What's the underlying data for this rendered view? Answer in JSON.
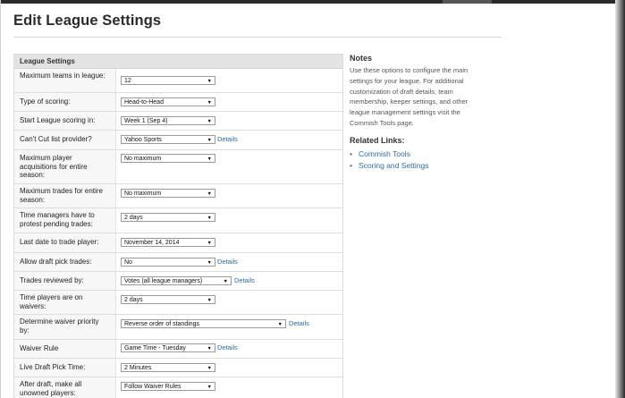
{
  "page_title": "Edit League Settings",
  "settings_header": "League Settings",
  "rows": [
    {
      "label": "Maximum teams in league:",
      "value": "12",
      "details": ""
    },
    {
      "label": "Type of scoring:",
      "value": "Head-to-Head",
      "details": ""
    },
    {
      "label": "Start League scoring in:",
      "value": "Week 1 (Sep 4)",
      "details": ""
    },
    {
      "label": "Can't Cut list provider?",
      "value": "Yahoo Sports",
      "details": "Details"
    },
    {
      "label": "Maximum player acquisitions for entire season:",
      "value": "No maximum",
      "details": ""
    },
    {
      "label": "Maximum trades for entire season:",
      "value": "No maximum",
      "details": ""
    },
    {
      "label": "Time managers have to protest pending trades:",
      "value": "2 days",
      "details": ""
    },
    {
      "label": "Last date to trade player:",
      "value": "November 14, 2014",
      "details": ""
    },
    {
      "label": "Allow draft pick trades:",
      "value": "No",
      "details": "Details"
    },
    {
      "label": "Trades reviewed by:",
      "value": "Votes (all league managers)",
      "details": "Details"
    },
    {
      "label": "Time players are on waivers:",
      "value": "2 days",
      "details": ""
    },
    {
      "label": "Determine waiver priority by:",
      "value": "Reverse order of standings",
      "details": "Details"
    },
    {
      "label": "Waiver Rule",
      "value": "Game Time - Tuesday",
      "details": "Details"
    },
    {
      "label": "Live Draft Pick Time:",
      "value": "2 Minutes",
      "details": ""
    },
    {
      "label": "After draft, make all unowned players:",
      "value": "Follow Waiver Rules",
      "details": ""
    }
  ],
  "notes": {
    "title": "Notes",
    "body": "Use these options to configure the main settings for your league. For additional customization of draft details, team membership, keeper settings, and other league management settings visit the Commish Tools page.",
    "related_title": "Related Links:",
    "links": [
      "Commish Tools",
      "Scoring and Settings"
    ]
  },
  "colors": {
    "link": "#2f6aa3",
    "row_background": "#f7f7f7",
    "header_background": "#e3e3e3"
  },
  "icons": {
    "dropdown": "triangle-down"
  }
}
